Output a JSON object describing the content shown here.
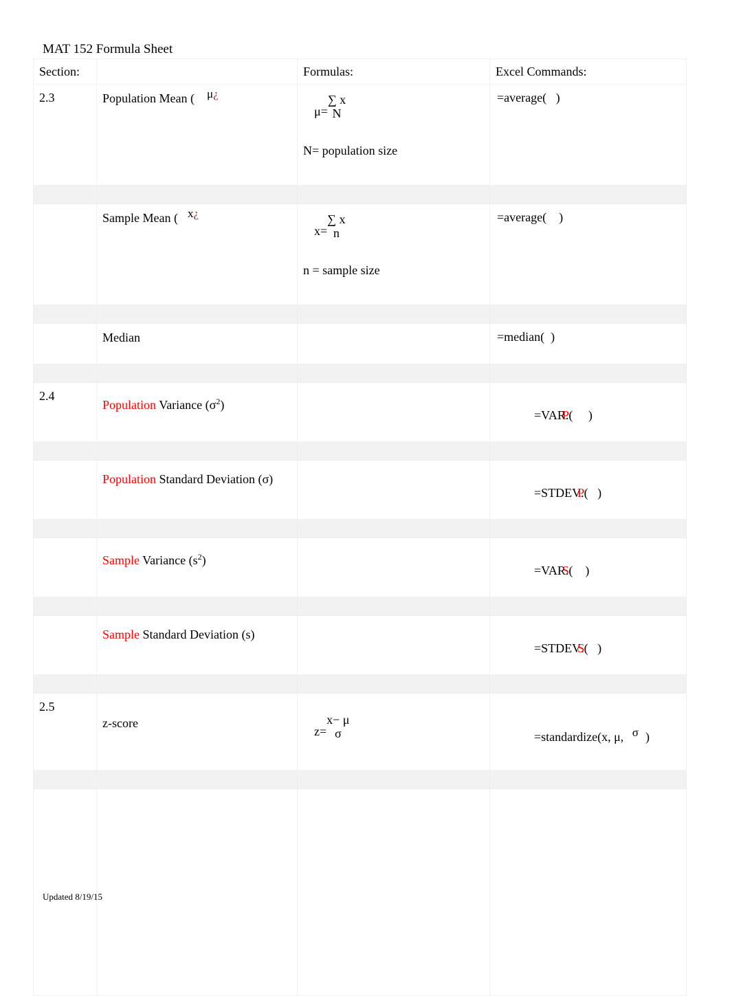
{
  "document": {
    "title": "MAT 152 Formula Sheet",
    "footer": "Updated 8/19/15"
  },
  "table": {
    "headers": {
      "section": "Section:",
      "formulas": "Formulas:",
      "excel": "Excel Commands:"
    },
    "rows": [
      {
        "section": "2.3",
        "name_prefix": "Population Mean (",
        "name_symbol": "μ",
        "name_symbol_suffix": "¿",
        "formula_lhs": "μ=",
        "formula_numerator": "∑ x",
        "formula_denominator": "N",
        "formula_note": "N= population size",
        "excel": "=average(   )"
      },
      {
        "section": "",
        "name_prefix": "Sample Mean (",
        "name_symbol": "x",
        "name_symbol_suffix": "¿",
        "formula_lhs": "x=",
        "formula_numerator": "∑ x",
        "formula_denominator": "n",
        "formula_note": "n = sample size",
        "excel": "=average(    )"
      },
      {
        "section": "",
        "name": "Median",
        "formula": "",
        "excel": "=median(  )"
      },
      {
        "section": "2.4",
        "name_red": "Population",
        "name_rest": " Variance (σ",
        "name_sup": "2",
        "name_tail": ")",
        "formula": "",
        "excel_pre": "=VAR",
        "excel_red": "P",
        "excel_post": ".(     )"
      },
      {
        "section": "",
        "name_red": "Population",
        "name_rest": " Standard Deviation (σ)",
        "formula": "",
        "excel_pre": "=STDEV",
        "excel_red": "P",
        "excel_post": ".(   )"
      },
      {
        "section": "",
        "name_red": "Sample",
        "name_rest": " Variance (s",
        "name_sup": "2",
        "name_tail": ")",
        "formula": "",
        "excel_pre": "=VAR",
        "excel_red": "S",
        "excel_post": ".(    )"
      },
      {
        "section": "",
        "name_red": "Sample",
        "name_rest": " Standard Deviation (s)",
        "formula": "",
        "excel_pre": "=STDEV",
        "excel_red": "S",
        "excel_post": ".(   )"
      },
      {
        "section": "2.5",
        "name": "z-score",
        "formula_lhs": "z=",
        "formula_numerator": "x− μ",
        "formula_denominator": "σ",
        "excel_pre": "=standardize(x, μ, ",
        "excel_symbol": "σ",
        "excel_post": ")"
      }
    ]
  },
  "colors": {
    "red": "#ff0000",
    "dark_red": "#9e2a2a",
    "border": "#f1f1f1",
    "spacer_fill": "#f2f2f2"
  }
}
